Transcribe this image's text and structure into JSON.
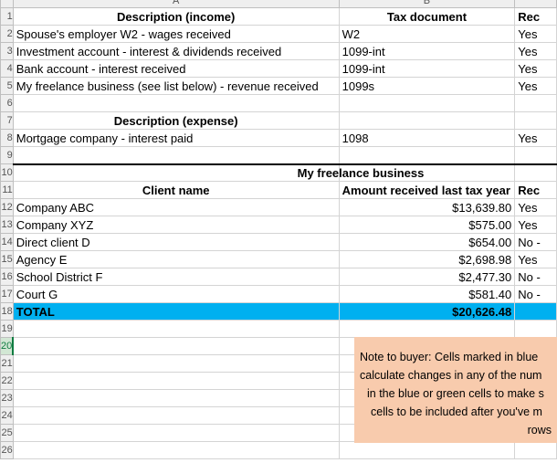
{
  "columns": [
    "A",
    "B"
  ],
  "rows": [
    {
      "row": "1",
      "a": "Description (income)",
      "b": "Tax document",
      "c": "Rec",
      "style": "hdr"
    },
    {
      "row": "2",
      "a": "Spouse's employer W2 - wages received",
      "b": "W2",
      "c": "Yes"
    },
    {
      "row": "3",
      "a": "Investment account - interest & dividends received",
      "b": "1099-int",
      "c": "Yes"
    },
    {
      "row": "4",
      "a": "Bank account - interest received",
      "b": "1099-int",
      "c": "Yes"
    },
    {
      "row": "5",
      "a": "My freelance business (see list below) - revenue received",
      "b": "1099s",
      "c": "Yes"
    },
    {
      "row": "6",
      "a": "",
      "b": "",
      "c": ""
    },
    {
      "row": "7",
      "a": "Description (expense)",
      "b": "",
      "c": "",
      "style": "hdr"
    },
    {
      "row": "8",
      "a": "Mortgage company - interest paid",
      "b": "1098",
      "c": "Yes"
    },
    {
      "row": "9",
      "a": "",
      "b": "",
      "c": ""
    },
    {
      "row": "10",
      "a": "",
      "b": "My freelance business",
      "c": "",
      "style": "section"
    },
    {
      "row": "11",
      "a": "Client name",
      "b": "Amount received last tax year",
      "c": "Rec",
      "style": "hdr2"
    },
    {
      "row": "12",
      "a": "Company ABC",
      "b": "$13,639.80",
      "c": "Yes"
    },
    {
      "row": "13",
      "a": "Company XYZ",
      "b": "$575.00",
      "c": "Yes"
    },
    {
      "row": "14",
      "a": "Direct client D",
      "b": "$654.00",
      "c": "No -"
    },
    {
      "row": "15",
      "a": "Agency E",
      "b": "$2,698.98",
      "c": "Yes"
    },
    {
      "row": "16",
      "a": "School District F",
      "b": "$2,477.30",
      "c": "No -"
    },
    {
      "row": "17",
      "a": "Court G",
      "b": "$581.40",
      "c": "No -"
    },
    {
      "row": "18",
      "a": "TOTAL",
      "b": "$20,626.48",
      "c": "",
      "style": "total"
    },
    {
      "row": "19",
      "a": "",
      "b": "",
      "c": ""
    },
    {
      "row": "20",
      "a": "",
      "b": "",
      "c": "",
      "active": true
    },
    {
      "row": "21",
      "a": "",
      "b": "",
      "c": ""
    },
    {
      "row": "22",
      "a": "",
      "b": "",
      "c": ""
    },
    {
      "row": "23",
      "a": "",
      "b": "",
      "c": ""
    },
    {
      "row": "24",
      "a": "",
      "b": "",
      "c": ""
    },
    {
      "row": "25",
      "a": "",
      "b": "",
      "c": ""
    },
    {
      "row": "26",
      "a": "",
      "b": "",
      "c": ""
    }
  ],
  "note": {
    "lines": [
      "Note to buyer: Cells marked in blue",
      "calculate changes in any of the num",
      "in the blue or green cells to make s",
      "cells to be included after you've m",
      "rows"
    ]
  },
  "colors": {
    "total_fill": "#00b0f0",
    "note_fill": "#f8cbad",
    "active_row": "#107c41"
  }
}
